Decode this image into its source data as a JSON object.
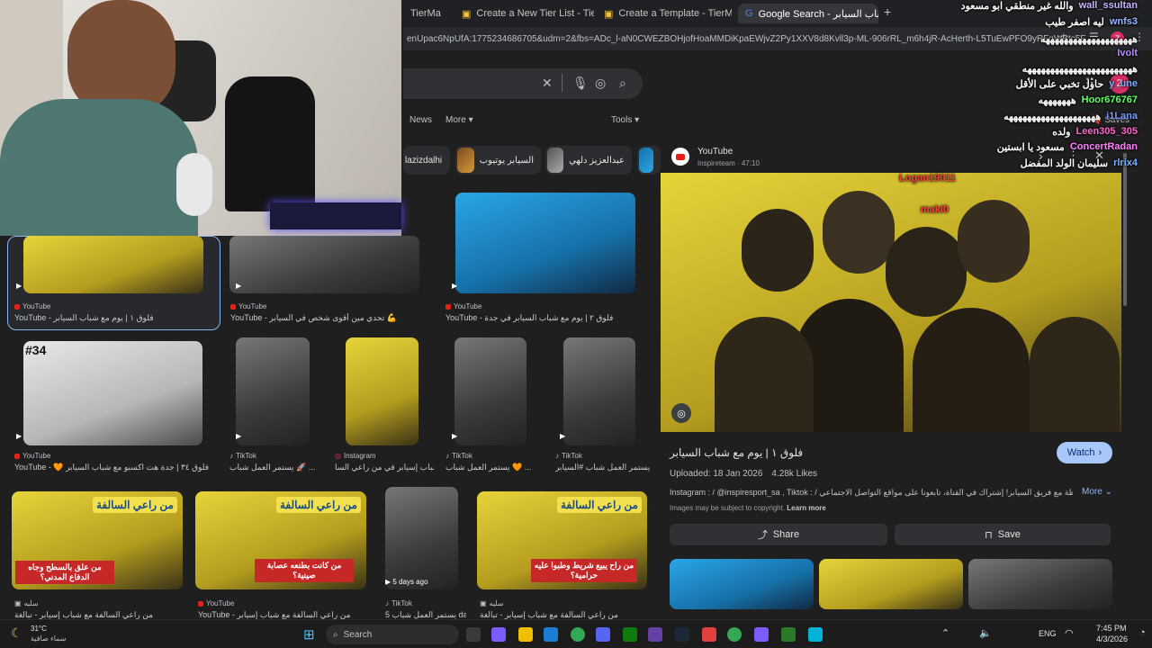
{
  "browser": {
    "tabs": [
      {
        "label": "TierMa"
      },
      {
        "label": "Create a New Tier List - TierMa"
      },
      {
        "label": "Create a Template - TierMaker"
      },
      {
        "label": "Google Search - شباب السيابر",
        "active": true
      }
    ],
    "new_tab": "+",
    "url": "enUpac6NpUfA:1775234686705&udm=2&fbs=ADc_l-aN0CWEZBOHjofHoaMMDiKpaEWjvZ2Py1XXV8d8Kvll3p-ML-906rRL_m6h4jR-AcHerth-L5TuEwPFO9yRFgWBtc5F...",
    "profile_initial": "Z"
  },
  "search": {
    "nav_tabs": [
      "News",
      "More",
      "Tools"
    ],
    "saves_label": "Saves",
    "chips": [
      "lazizdalhi",
      "السيابر يوتيوب",
      "عبدالعزيز دلهي"
    ]
  },
  "results": [
    {
      "src": "YouTube",
      "cap": "YouTube - فلوق ١ | يوم مع شباب السيابر"
    },
    {
      "src": "YouTube",
      "cap": "YouTube - تحدي مين أقوى شخص في السيابر 💪"
    },
    {
      "src": "YouTube",
      "cap": "YouTube - فلوق ٢ | يوم مع شباب السيابر في جدة"
    },
    {
      "src": "YouTube",
      "cap": "YouTube - 🧡 فلوق ٣٤ | جدة هت اكسبو مع شباب السيابر",
      "badge": "#34"
    },
    {
      "src": "TikTok",
      "cap": "يستمر العمل شباب 🚀 ..."
    },
    {
      "src": "Instagram",
      "cap": "شباب إسيابر في من راعي السا..."
    },
    {
      "src": "TikTok",
      "cap": "يستمر العمل شباب 🧡 ..."
    },
    {
      "src": "TikTok",
      "cap": "يستمر العمل شباب #السيابر"
    },
    {
      "src": "سليه",
      "cap": "من راعي السالفة مع شباب إسيابر - تبالغة",
      "overlay": "من علق بالسطح وجاه الدفاع المدني؟",
      "tag": "من راعي السالفة"
    },
    {
      "src": "YouTube",
      "cap": "YouTube - من راعي السالفة مع شباب إسيابر",
      "overlay": "من كانت بطنعه عصابة صينية؟",
      "tag": "من راعي السالفة"
    },
    {
      "src": "TikTok",
      "cap": "يستمر العمل شباب 5 days ago",
      "time": "5 days ago"
    },
    {
      "src": "سليه",
      "cap": "من راعي السالفة مع شباب إسيابر - تبالغة",
      "overlay": "من راح يبيع شريط وطبوا عليه حرامية؟",
      "tag": "من راعي السالفة"
    }
  ],
  "panel": {
    "source_name": "YouTube",
    "channel": "Inspireteam",
    "duration": "47:10",
    "title": "فلوق ١ | يوم مع شباب السيابر",
    "watch_label": "Watch",
    "uploaded": "Uploaded: 18 Jan 2026",
    "likes": "4.28k Likes",
    "desc": "Instagram : / @inspiresport_sa , Tiktok : / عيش اللحظة مع فريق السيابر! إشتراك في القناة، تابعونا على مواقع التواصل الاجتماعي",
    "more_label": "More",
    "copyright": "Images may be subject to copyright.",
    "learn_more": "Learn more",
    "share_label": "Share",
    "save_label": "Save"
  },
  "chat": [
    {
      "user": "wall_ssultan",
      "msg": "والله غير منطقي ابو مسعود",
      "color": "#c9b3ff"
    },
    {
      "user": "wnfs3",
      "msg": "ليه اصفر طيب",
      "color": "#9ab5ff"
    },
    {
      "user": "",
      "msg": "ههههههههههههههههههههه",
      "color": "#ffffff"
    },
    {
      "user": "Ivolt",
      "msg": "",
      "color": "#b18cff"
    },
    {
      "user": "",
      "msg": "ههههههههههههههههههههههههه",
      "color": "#ffffff"
    },
    {
      "user": "y_une",
      "msg": "حاول تخبي على الأقل",
      "color": "#7ab0ff"
    },
    {
      "user": "Hoor676767",
      "msg": "هههههههه",
      "color": "#66ff66"
    },
    {
      "user": "i1Lana",
      "msg": "ههههههههههههههههههههه",
      "color": "#7a9bff"
    },
    {
      "user": "Leen305_305",
      "msg": "ولده",
      "color": "#ff66cc"
    },
    {
      "user": "ConcertRadan",
      "msg": "مسعود يا ابستين",
      "color": "#ff80ff"
    },
    {
      "user": "rlrix4",
      "msg": "سليمان الولد المفضل",
      "color": "#7ab0ff"
    },
    {
      "user": "Logan19011",
      "msg": "",
      "color": "#ff4040"
    },
    {
      "user": "maki0",
      "msg": "",
      "color": "#ff4040"
    }
  ],
  "taskbar": {
    "weather_temp": "31°C",
    "weather_desc": "سماء صافية",
    "search_label": "Search",
    "lang": "ENG",
    "time": "7:45 PM",
    "date": "4/3/2026"
  }
}
